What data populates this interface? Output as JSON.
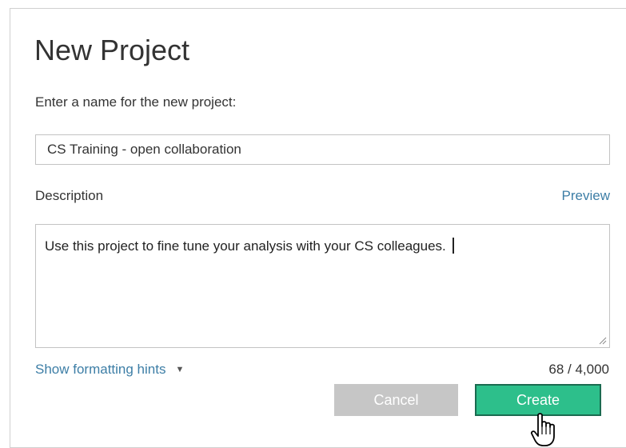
{
  "dialog": {
    "title": "New Project",
    "name_label": "Enter a name for the new project:",
    "name_value": "CS Training - open collaboration",
    "description_label": "Description",
    "preview_link": "Preview",
    "description_value": "Use this project to fine tune your analysis with your CS colleagues.",
    "formatting_hints": "Show formatting hints",
    "char_counter": "68 / 4,000",
    "cancel_label": "Cancel",
    "create_label": "Create"
  },
  "icons": {
    "hints_toggle": "caret-down-icon",
    "cursor": "hand-pointer-icon",
    "resize": "resize-grip-icon"
  },
  "colors": {
    "link": "#3d7ea6",
    "create_button": "#2dbf8b",
    "cancel_button": "#c6c6c6"
  }
}
